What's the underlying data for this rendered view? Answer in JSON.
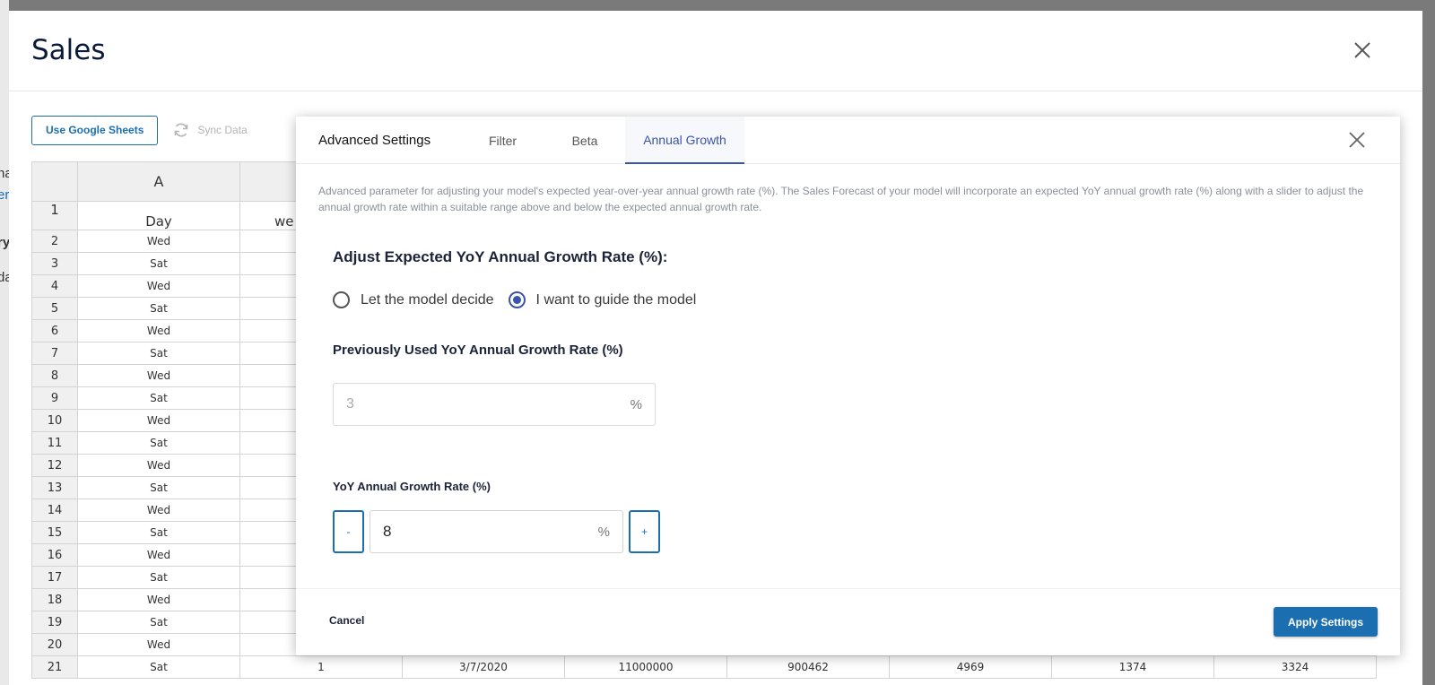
{
  "sales": {
    "title": "Sales",
    "use_google_sheets": "Use Google Sheets",
    "sync_data": "Sync Data"
  },
  "sheet": {
    "col_a": "A",
    "header_a": "Day",
    "header_b": "we",
    "rows": [
      {
        "n": "2",
        "day": "Wed"
      },
      {
        "n": "3",
        "day": "Sat"
      },
      {
        "n": "4",
        "day": "Wed"
      },
      {
        "n": "5",
        "day": "Sat"
      },
      {
        "n": "6",
        "day": "Wed"
      },
      {
        "n": "7",
        "day": "Sat"
      },
      {
        "n": "8",
        "day": "Wed"
      },
      {
        "n": "9",
        "day": "Sat"
      },
      {
        "n": "10",
        "day": "Wed"
      },
      {
        "n": "11",
        "day": "Sat"
      },
      {
        "n": "12",
        "day": "Wed"
      },
      {
        "n": "13",
        "day": "Sat"
      },
      {
        "n": "14",
        "day": "Wed"
      },
      {
        "n": "15",
        "day": "Sat"
      },
      {
        "n": "16",
        "day": "Wed"
      },
      {
        "n": "17",
        "day": "Sat"
      },
      {
        "n": "18",
        "day": "Wed"
      },
      {
        "n": "19",
        "day": "Sat"
      },
      {
        "n": "20",
        "day": "Wed"
      }
    ],
    "last_row": {
      "n": "21",
      "cells": [
        "Sat",
        "1",
        "3/7/2020",
        "11000000",
        "900462",
        "4969",
        "1374",
        "3324"
      ]
    }
  },
  "advanced": {
    "tabs": [
      "Advanced Settings",
      "Filter",
      "Beta",
      "Annual Growth"
    ],
    "description": "Advanced parameter for adjusting your model's expected year-over-year annual growth rate (%). The Sales Forecast of your model will incorporate an expected YoY annual growth rate (%) along with a slider to adjust the annual growth rate within a suitable range above and below the expected annual growth rate.",
    "section_title": "Adjust Expected YoY Annual Growth Rate (%):",
    "radio_auto": "Let the model decide",
    "radio_guide": "I want to guide the model",
    "prev_label": "Previously Used YoY Annual Growth Rate (%)",
    "prev_value": "3",
    "pct": "%",
    "yoy_label": "YoY Annual Growth Rate (%)",
    "yoy_value": "8",
    "minus": "-",
    "plus": "+",
    "cancel": "Cancel",
    "apply": "Apply Settings"
  },
  "peek": [
    "na",
    "er",
    "ry",
    "da"
  ]
}
